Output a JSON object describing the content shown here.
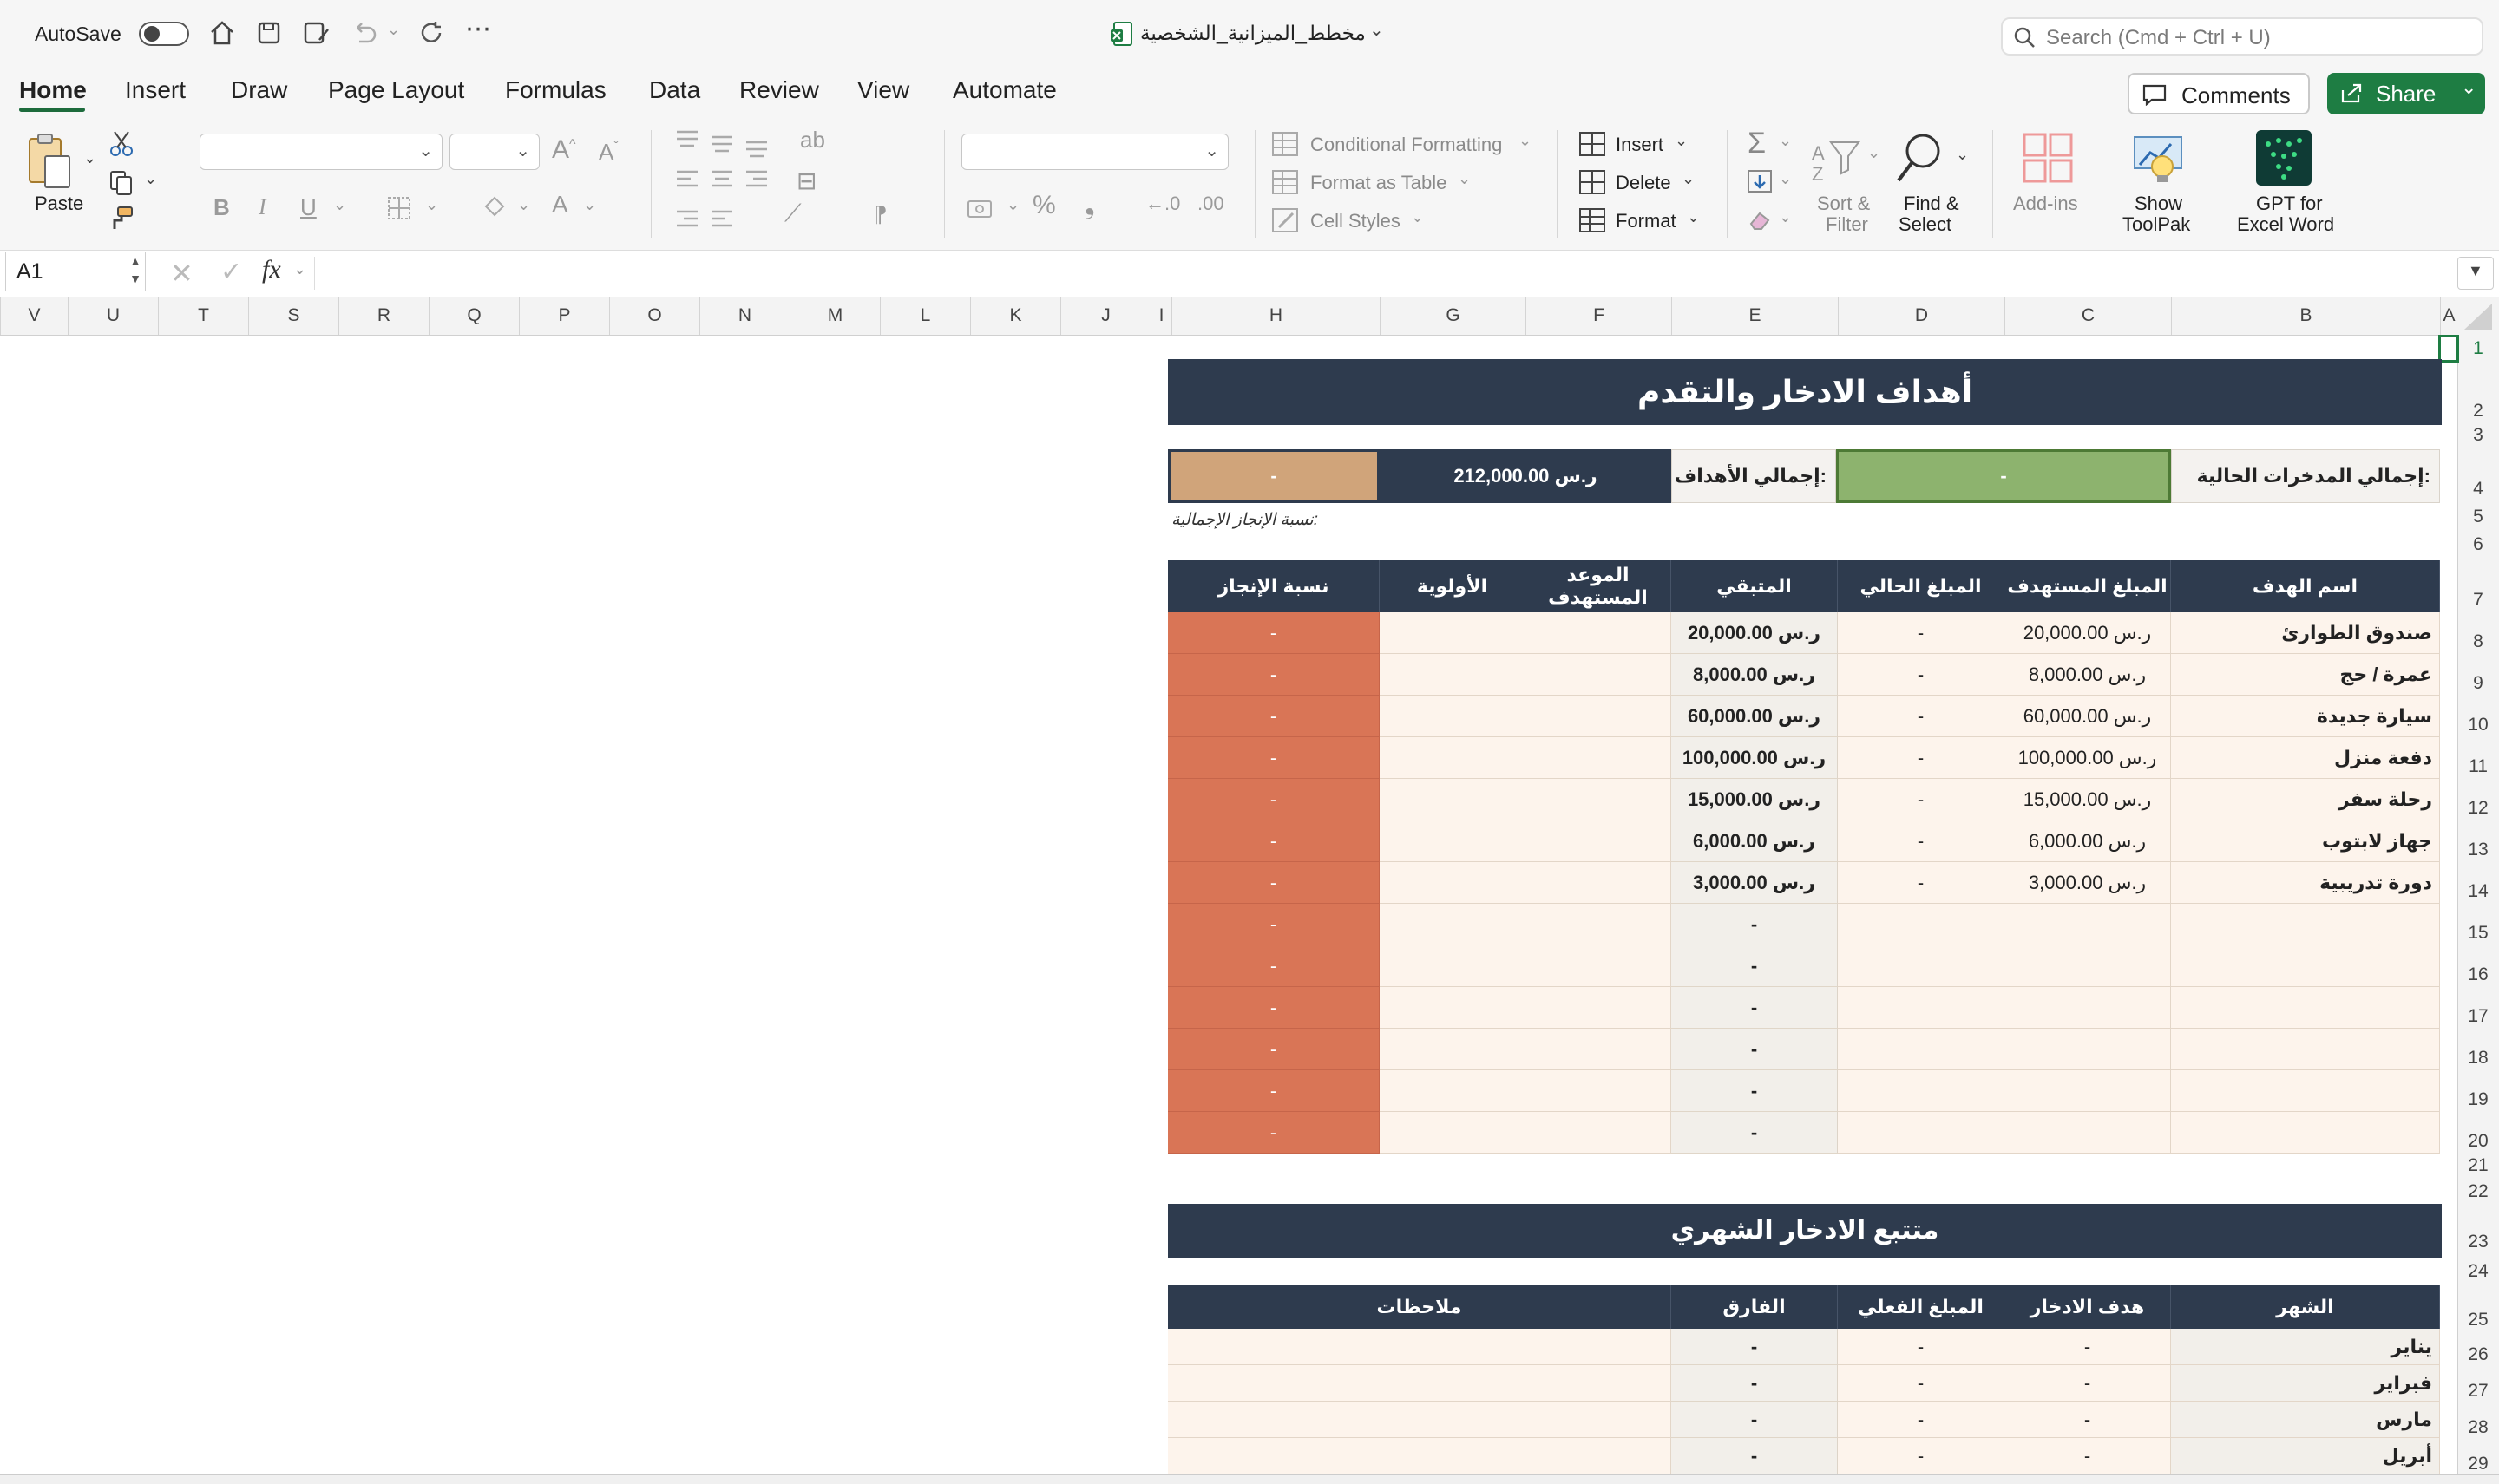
{
  "titlebar": {
    "autosave_label": "AutoSave",
    "file_name": "مخطط_الميزانية_الشخصية",
    "search_placeholder": "Search (Cmd + Ctrl + U)"
  },
  "tabs": [
    "Home",
    "Insert",
    "Draw",
    "Page Layout",
    "Formulas",
    "Data",
    "Review",
    "View",
    "Automate"
  ],
  "active_tab": "Home",
  "actions": {
    "comments": "Comments",
    "share": "Share"
  },
  "ribbon": {
    "paste": "Paste",
    "conditional_formatting": "Conditional Formatting",
    "format_as_table": "Format as Table",
    "cell_styles": "Cell Styles",
    "insert": "Insert",
    "delete": "Delete",
    "format": "Format",
    "sort_filter_1": "Sort &",
    "sort_filter_2": "Filter",
    "find_select_1": "Find &",
    "find_select_2": "Select",
    "add_ins": "Add-ins",
    "toolpak_1": "Show",
    "toolpak_2": "ToolPak",
    "gpt_1": "GPT for",
    "gpt_2": "Excel Word",
    "bold": "B",
    "italic": "I",
    "underline": "U"
  },
  "formula_bar": {
    "name_box": "A1",
    "fx": "fx"
  },
  "columns": [
    "V",
    "U",
    "T",
    "S",
    "R",
    "Q",
    "P",
    "O",
    "N",
    "M",
    "L",
    "K",
    "J",
    "I",
    "H",
    "G",
    "F",
    "E",
    "D",
    "C",
    "B",
    "A"
  ],
  "rows": [
    "1",
    "2",
    "3",
    "4",
    "5",
    "6",
    "7",
    "8",
    "9",
    "10",
    "11",
    "12",
    "13",
    "14",
    "15",
    "16",
    "17",
    "18",
    "19",
    "20",
    "21",
    "22",
    "23",
    "24",
    "25",
    "26",
    "27",
    "28",
    "29"
  ],
  "sheet": {
    "title": "أهداف الادخار والتقدم",
    "summary": {
      "current_savings_label": "إجمالي المدخرات الحالية:",
      "current_savings_value": "-",
      "total_goals_label": "إجمالي الأهداف:",
      "total_goals_value": "ر.س 212,000.00",
      "progress_value": "-",
      "progress_caption": "نسبة الإنجاز الإجمالية:"
    },
    "goals_headers": [
      "اسم الهدف",
      "المبلغ المستهدف",
      "المبلغ الحالي",
      "المتبقي",
      "الموعد المستهدف",
      "الأولوية",
      "نسبة الإنجاز"
    ],
    "goals": [
      {
        "name": "صندوق الطوارئ",
        "target": "ر.س 20,000.00",
        "current": "-",
        "remaining": "ر.س 20,000.00",
        "date": "",
        "priority": "",
        "pct": "-"
      },
      {
        "name": "عمرة / حج",
        "target": "ر.س 8,000.00",
        "current": "-",
        "remaining": "ر.س 8,000.00",
        "date": "",
        "priority": "",
        "pct": "-"
      },
      {
        "name": "سيارة جديدة",
        "target": "ر.س 60,000.00",
        "current": "-",
        "remaining": "ر.س 60,000.00",
        "date": "",
        "priority": "",
        "pct": "-"
      },
      {
        "name": "دفعة منزل",
        "target": "ر.س 100,000.00",
        "current": "-",
        "remaining": "ر.س 100,000.00",
        "date": "",
        "priority": "",
        "pct": "-"
      },
      {
        "name": "رحلة سفر",
        "target": "ر.س 15,000.00",
        "current": "-",
        "remaining": "ر.س 15,000.00",
        "date": "",
        "priority": "",
        "pct": "-"
      },
      {
        "name": "جهاز لابتوب",
        "target": "ر.س 6,000.00",
        "current": "-",
        "remaining": "ر.س 6,000.00",
        "date": "",
        "priority": "",
        "pct": "-"
      },
      {
        "name": "دورة تدريبية",
        "target": "ر.س 3,000.00",
        "current": "-",
        "remaining": "ر.س 3,000.00",
        "date": "",
        "priority": "",
        "pct": "-"
      },
      {
        "name": "",
        "target": "",
        "current": "",
        "remaining": "-",
        "date": "",
        "priority": "",
        "pct": "-"
      },
      {
        "name": "",
        "target": "",
        "current": "",
        "remaining": "-",
        "date": "",
        "priority": "",
        "pct": "-"
      },
      {
        "name": "",
        "target": "",
        "current": "",
        "remaining": "-",
        "date": "",
        "priority": "",
        "pct": "-"
      },
      {
        "name": "",
        "target": "",
        "current": "",
        "remaining": "-",
        "date": "",
        "priority": "",
        "pct": "-"
      },
      {
        "name": "",
        "target": "",
        "current": "",
        "remaining": "-",
        "date": "",
        "priority": "",
        "pct": "-"
      },
      {
        "name": "",
        "target": "",
        "current": "",
        "remaining": "-",
        "date": "",
        "priority": "",
        "pct": "-"
      }
    ],
    "tracker_title": "متتبع الادخار الشهري",
    "tracker_headers": [
      "الشهر",
      "هدف الادخار",
      "المبلغ الفعلي",
      "الفارق",
      "ملاحظات"
    ],
    "months": [
      {
        "month": "يناير",
        "goal": "-",
        "actual": "-",
        "diff": "-",
        "notes": ""
      },
      {
        "month": "فبراير",
        "goal": "-",
        "actual": "-",
        "diff": "-",
        "notes": ""
      },
      {
        "month": "مارس",
        "goal": "-",
        "actual": "-",
        "diff": "-",
        "notes": ""
      },
      {
        "month": "أبريل",
        "goal": "-",
        "actual": "-",
        "diff": "-",
        "notes": ""
      }
    ]
  },
  "colors": {
    "header_dark": "#2e3b4e",
    "accent_green": "#1e7d43",
    "progress_tan": "#d0a47a",
    "savings_green": "#8db36e",
    "pct_orange": "#d97556",
    "body_cream": "#fdf4ec"
  }
}
